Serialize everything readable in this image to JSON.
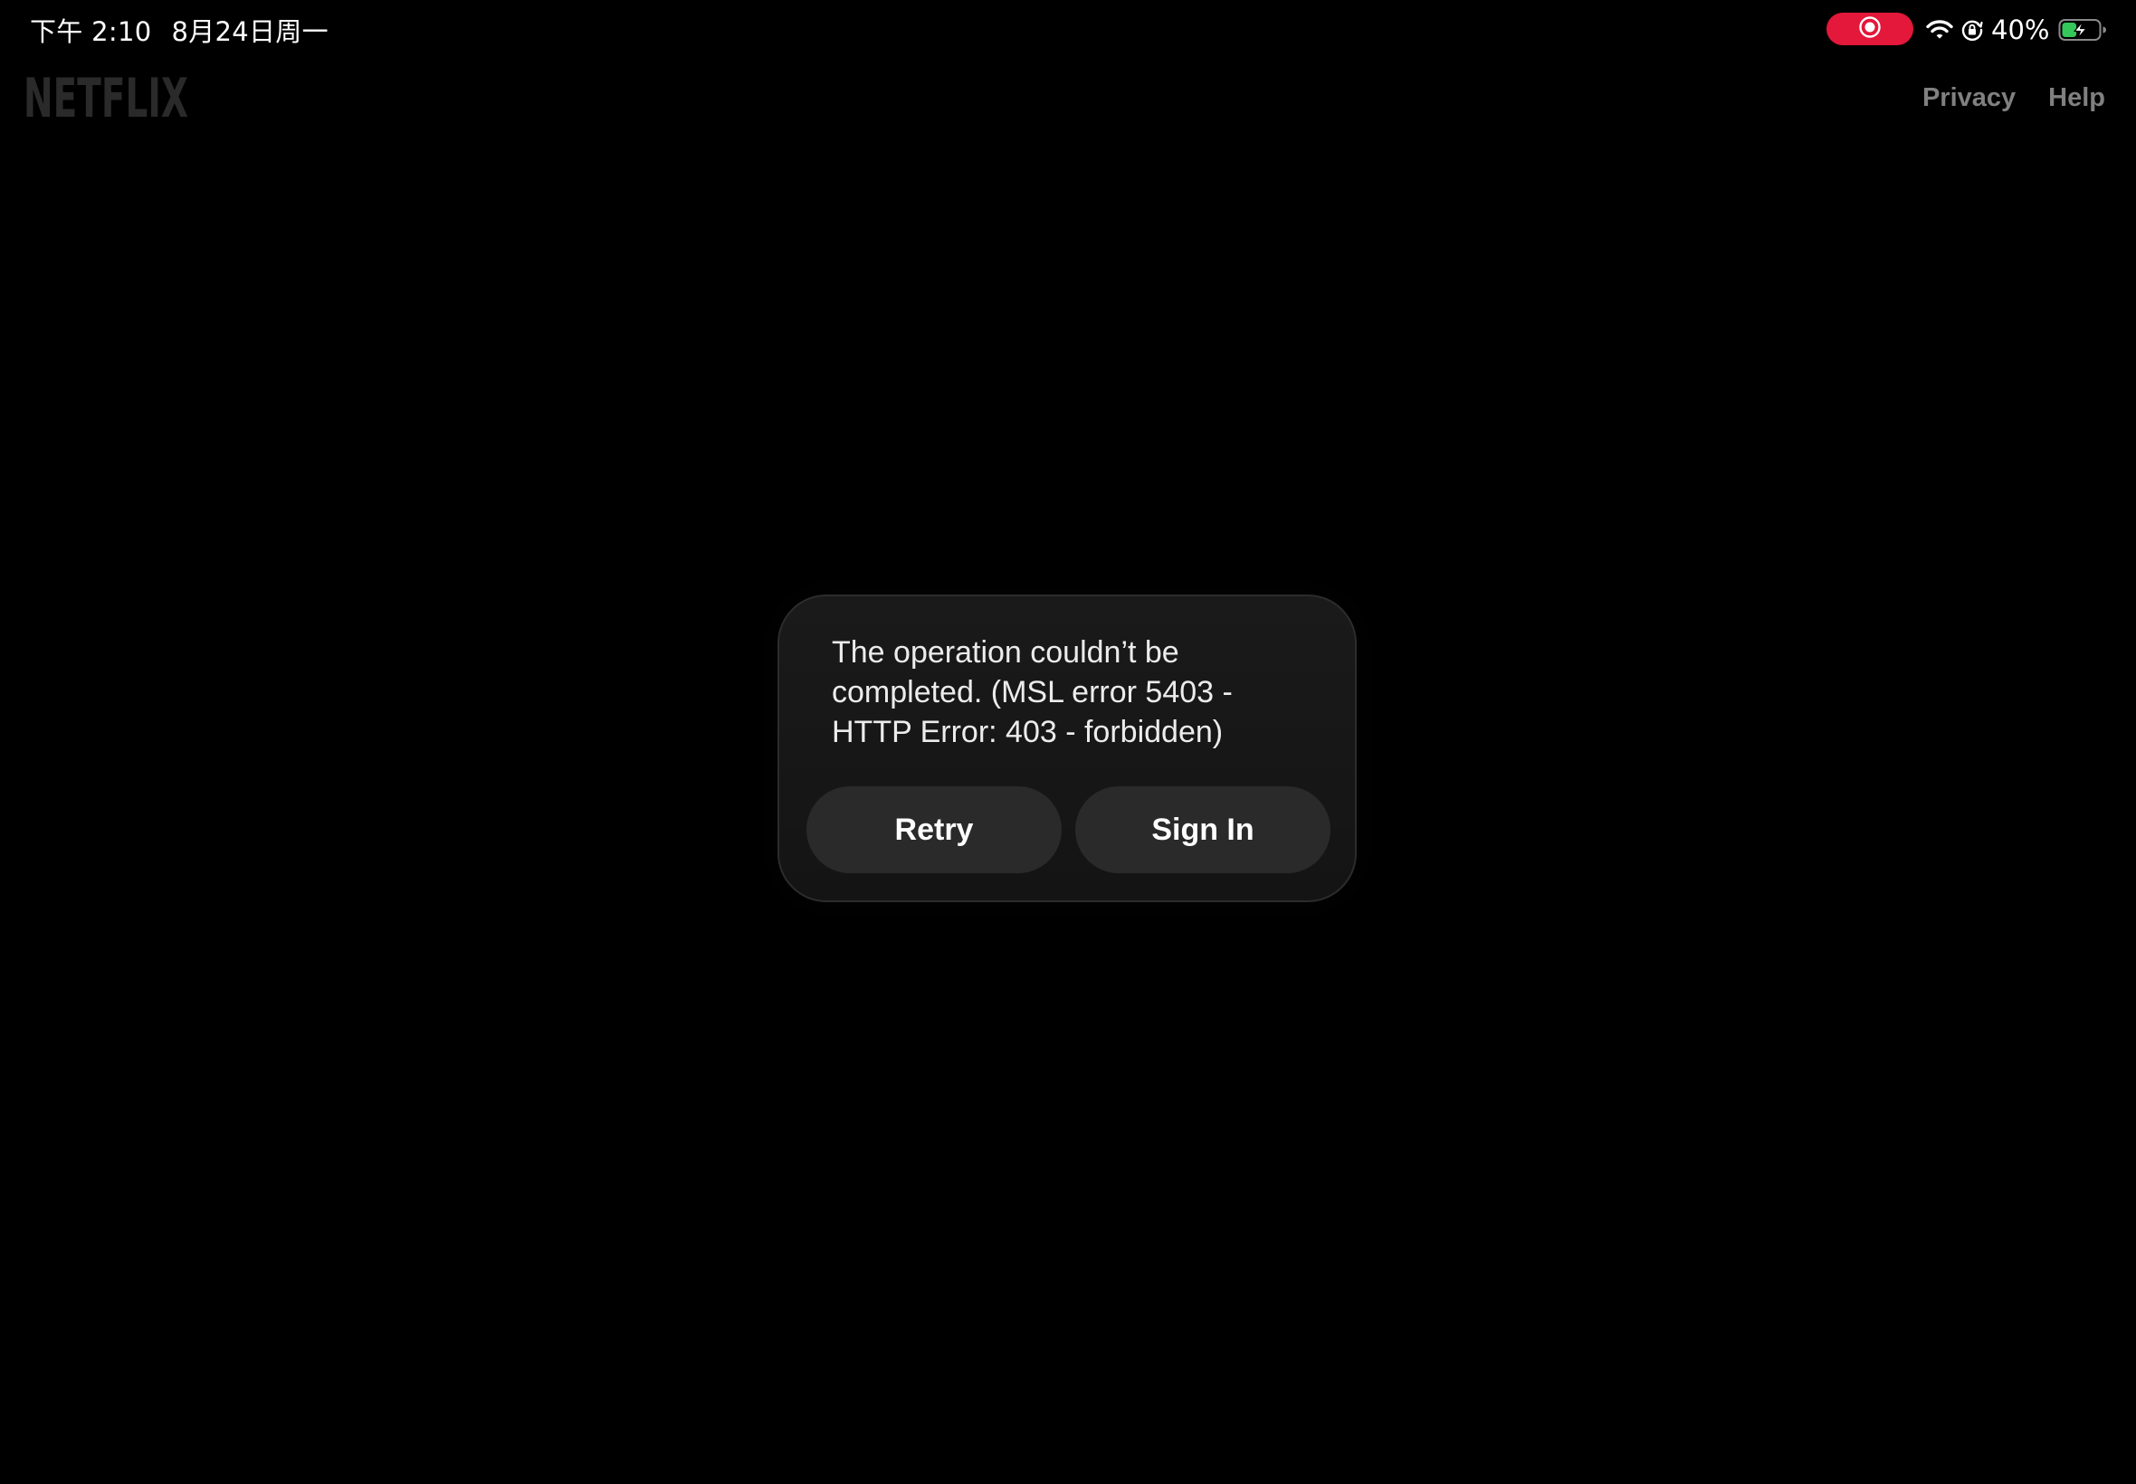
{
  "status_bar": {
    "time": "下午 2:10",
    "date": "8月24日周一",
    "battery_percent": "40%",
    "battery_level": 0.4,
    "battery_charging": true,
    "recording": true,
    "icons": [
      "screen-recording-icon",
      "wifi-icon",
      "orientation-lock-icon",
      "battery-charging-icon"
    ],
    "record_color": "#e3183a",
    "battery_fill_color": "#34c759"
  },
  "header": {
    "logo_text": "NETFLIX",
    "logo_color": "#2a2a2a",
    "links": {
      "privacy": "Privacy",
      "help": "Help"
    }
  },
  "alert": {
    "message": "The operation couldn’t be completed. (MSL error 5403 - HTTP Error: 403 - forbidden)",
    "buttons": {
      "retry": "Retry",
      "sign_in": "Sign In"
    }
  }
}
